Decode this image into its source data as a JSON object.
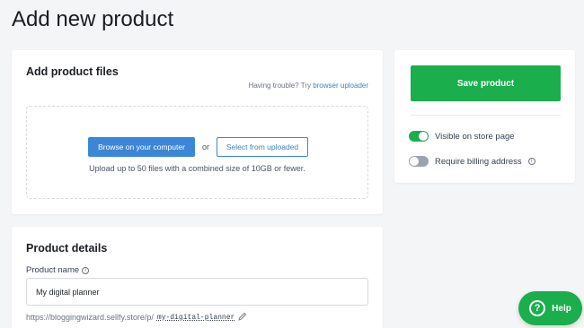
{
  "page": {
    "title": "Add new product"
  },
  "files": {
    "heading": "Add product files",
    "trouble_text": "Having trouble? Try",
    "trouble_link": "browser uploader",
    "browse_label": "Browse on your computer",
    "or_text": "or",
    "select_label": "Select from uploaded",
    "hint": "Upload up to 50 files with a combined size of 10GB or fewer."
  },
  "details": {
    "heading": "Product details",
    "name_label": "Product name",
    "name_value": "My digital planner",
    "url_base": "https://bloggingwizard.sellfy.store/p/",
    "url_slug": "my-digital-planner"
  },
  "sidebar": {
    "save_label": "Save product",
    "visible_label": "Visible on store page",
    "visible_on": true,
    "billing_label": "Require billing address",
    "billing_on": false
  },
  "help": {
    "label": "Help"
  },
  "colors": {
    "accent_green": "#1aae4d",
    "link_blue": "#3b82c4",
    "button_blue": "#3b86d6"
  },
  "icons": [
    "info-icon",
    "pencil-icon",
    "question-icon"
  ]
}
